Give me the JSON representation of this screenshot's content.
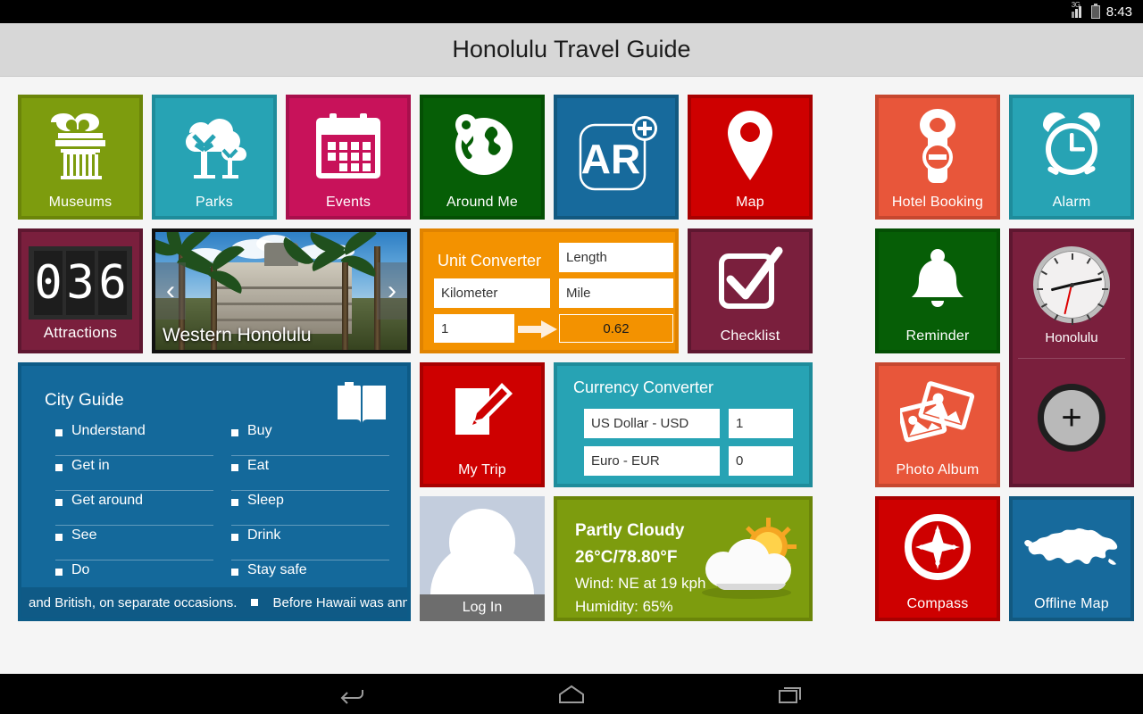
{
  "statusbar": {
    "network": "3G",
    "time": "8:43",
    "signal_icon": "signal-bars-icon",
    "battery_icon": "battery-icon"
  },
  "titlebar": {
    "title": "Honolulu Travel Guide"
  },
  "tiles": {
    "museums": {
      "label": "Museums",
      "icon": "museum-column-icon",
      "color": "#7d9c0e"
    },
    "parks": {
      "label": "Parks",
      "icon": "tree-icon",
      "color": "#27a3b4"
    },
    "events": {
      "label": "Events",
      "icon": "calendar-icon",
      "color": "#c8125a"
    },
    "around_me": {
      "label": "Around Me",
      "icon": "globe-pin-icon",
      "color": "#065e06"
    },
    "ar": {
      "label": "",
      "icon": "ar-plus-icon",
      "text": "AR",
      "color": "#176a9c"
    },
    "map": {
      "label": "Map",
      "icon": "map-pin-icon",
      "color": "#ce0000"
    },
    "hotel": {
      "label": "Hotel Booking",
      "icon": "door-hanger-icon",
      "color": "#e8563a"
    },
    "alarm": {
      "label": "Alarm",
      "icon": "alarm-clock-icon",
      "color": "#27a3b4"
    },
    "checklist": {
      "label": "Checklist",
      "icon": "checkbox-check-icon",
      "color": "#7a1f3d"
    },
    "reminder": {
      "label": "Reminder",
      "icon": "bell-icon",
      "color": "#065e06"
    },
    "photo": {
      "label": "Photo Album",
      "icon": "photos-icon",
      "color": "#e8563a"
    },
    "compass": {
      "label": "Compass",
      "icon": "compass-icon",
      "color": "#ce0000"
    },
    "offline": {
      "label": "Offline Map",
      "icon": "island-map-icon",
      "color": "#176a9c"
    },
    "mytrip": {
      "label": "My Trip",
      "icon": "note-pencil-icon",
      "color": "#ce0000"
    }
  },
  "attractions": {
    "label": "Attractions",
    "count": "036",
    "digits": [
      "0",
      "3",
      "6"
    ]
  },
  "featured": {
    "caption": "Western Honolulu",
    "prev_icon": "chevron-left-icon",
    "next_icon": "chevron-right-icon"
  },
  "unit_converter": {
    "title": "Unit Converter",
    "category": "Length",
    "from_unit": "Kilometer",
    "to_unit": "Mile",
    "from_value": "1",
    "to_value": "0.62",
    "arrow_icon": "arrow-right-icon"
  },
  "currency_converter": {
    "title": "Currency Converter",
    "from_currency": "US Dollar - USD",
    "from_amount": "1",
    "to_currency": "Euro - EUR",
    "to_amount": "0"
  },
  "city_guide": {
    "title": "City Guide",
    "icon": "open-book-icon",
    "left_items": [
      "Understand",
      "Get in",
      "Get around",
      "See",
      "Do"
    ],
    "right_items": [
      "Buy",
      "Eat",
      "Sleep",
      "Drink",
      "Stay safe"
    ],
    "ticker_left": "and British, on separate occasions.",
    "ticker_right": "Before Hawaii was annex"
  },
  "weather": {
    "condition": "Partly Cloudy",
    "temperature": "26°C/78.80°F",
    "wind": "Wind: NE at 19 kph",
    "humidity": "Humidity: 65%",
    "icon": "sun-cloud-icon"
  },
  "login": {
    "label": "Log In",
    "icon": "avatar-icon"
  },
  "world_clock": {
    "city": "Honolulu",
    "clock_icon": "analog-clock-icon",
    "add_label": "+",
    "add_icon": "add-circle-icon"
  },
  "navbar": {
    "back": "back-icon",
    "home": "home-icon",
    "recents": "recents-icon"
  }
}
